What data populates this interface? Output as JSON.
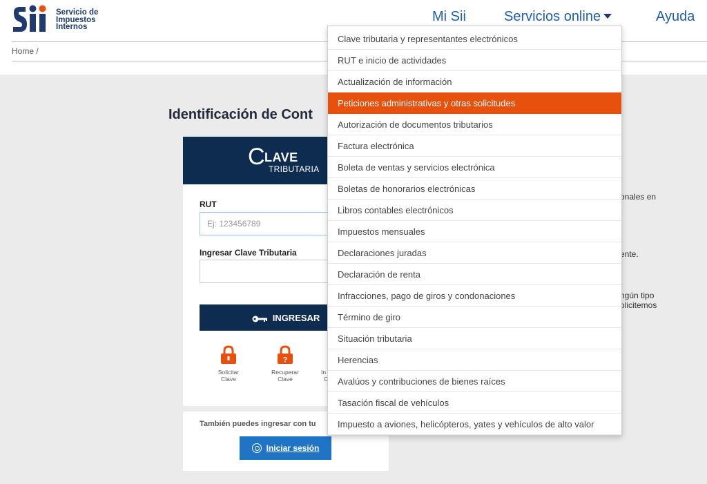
{
  "header": {
    "logo_text": [
      "Servicio de",
      "Impuestos",
      "Internos"
    ],
    "nav": {
      "mi_sii": "Mi Sii",
      "servicios": "Servicios online",
      "ayuda": "Ayuda"
    },
    "breadcrumb": "Home /"
  },
  "main": {
    "title": "Identificación de Cont",
    "clave_logo": {
      "c": "C",
      "lave": "LAVE",
      "trib": "TRIBUTARIA"
    },
    "rut_label": "RUT",
    "rut_placeholder": "Ej: 123456789",
    "clave_label": "Ingresar Clave Tributaria",
    "ingresar_label": "INGRESAR",
    "options": [
      {
        "line1": "Solicitar",
        "line2": "Clave"
      },
      {
        "line1": "Recuperar",
        "line2": "Clave"
      },
      {
        "line1": "In",
        "line2": "C"
      }
    ],
    "also_text": "También puedes ingresar con tu",
    "iniciar_label": "Iniciar sesión",
    "side_texts": [
      "onales en",
      "ente.",
      "ngún tipo",
      "olicitemos"
    ]
  },
  "dropdown": {
    "active_index": 3,
    "items": [
      "Clave tributaria y representantes electrónicos",
      "RUT e inicio de actividades",
      "Actualización de información",
      "Peticiones administrativas y otras solicitudes",
      "Autorización de documentos tributarios",
      "Factura electrónica",
      "Boleta de ventas y servicios electrónica",
      "Boletas de honorarios electrónicas",
      "Libros contables electrónicos",
      "Impuestos mensuales",
      "Declaraciones juradas",
      "Declaración de renta",
      "Infracciones, pago de giros y condonaciones",
      "Término de giro",
      "Situación tributaria",
      "Herencias",
      "Avalúos y contribuciones de bienes raíces",
      "Tasación fiscal de vehículos",
      "Impuesto a aviones, helicópteros, yates y vehículos de alto valor"
    ]
  },
  "colors": {
    "brand_navy": "#0d2c4f",
    "link_blue": "#1f5fa8",
    "accent_orange": "#e8500e",
    "button_blue": "#1f74c6"
  }
}
